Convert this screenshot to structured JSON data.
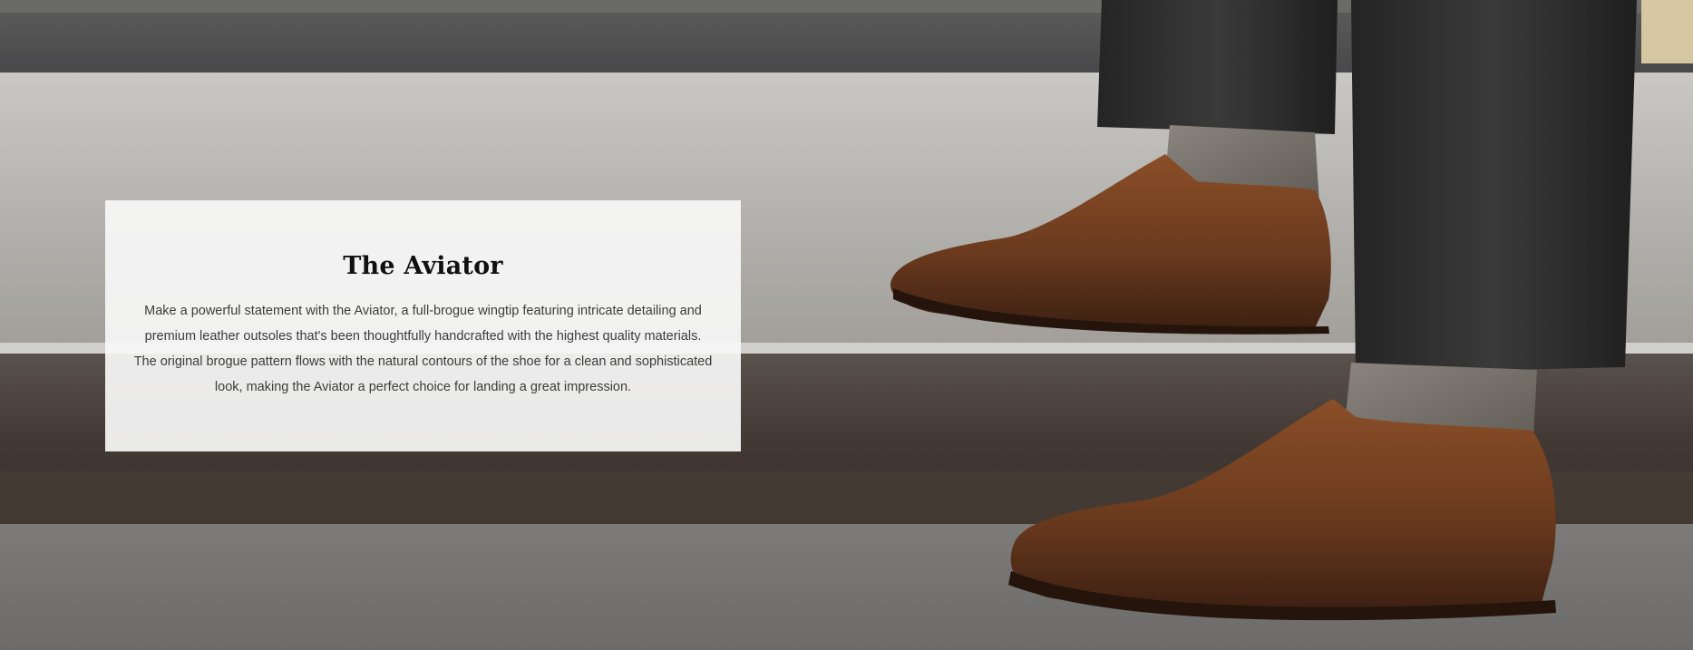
{
  "hero": {
    "image_alt": "Brown full-brogue wingtip leather shoes worn with charcoal trousers on stone steps",
    "card": {
      "title": "The Aviator",
      "body": "Make a powerful statement with the Aviator, a full-brogue wingtip featuring intricate detailing and premium leather outsoles that's been thoughtfully handcrafted with the highest quality materials. The original brogue pattern flows with the natural contours of the shoe for a clean and sophisticated look, making the Aviator a perfect choice for landing a great impression."
    }
  },
  "colors": {
    "card_background": "#f8f8f8",
    "title_text": "#111111",
    "body_text": "#3d3d3d",
    "leather_brown": "#6b3a1e",
    "trouser_charcoal": "#2e2e2e",
    "concrete_gray": "#9a9895"
  }
}
